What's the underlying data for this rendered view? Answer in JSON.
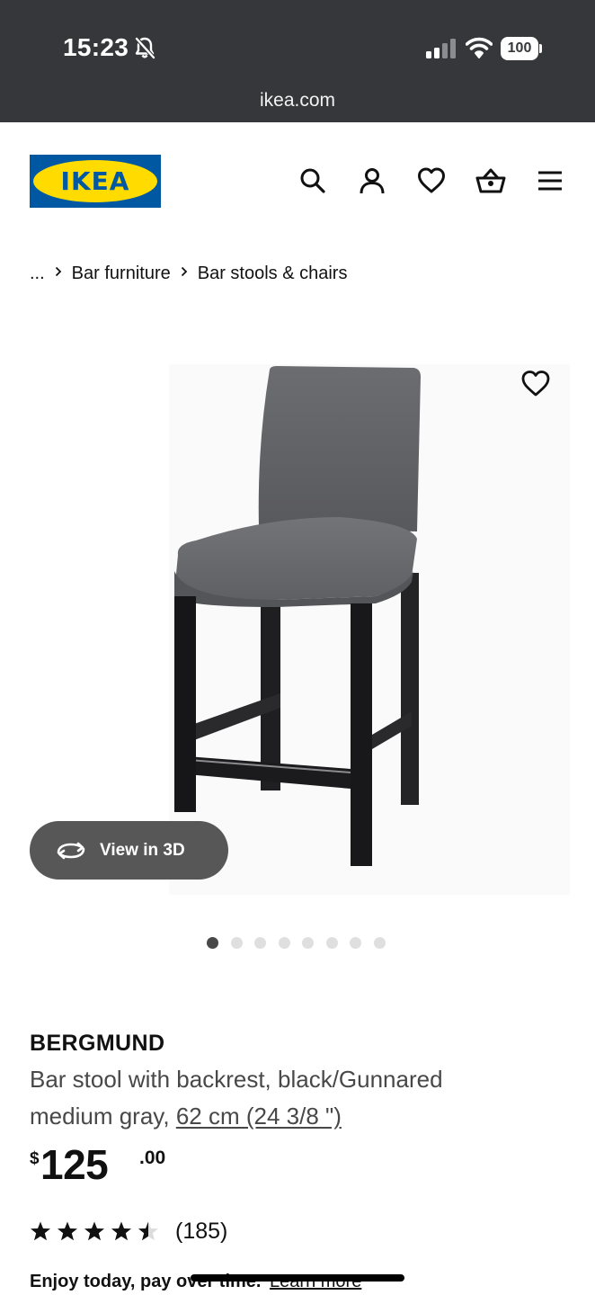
{
  "status_bar": {
    "time": "15:23",
    "battery": "100",
    "url": "ikea.com",
    "icons": [
      "bell-slash-icon",
      "signal-icon",
      "wifi-icon",
      "battery-icon"
    ]
  },
  "header": {
    "logo_text": "IKEA",
    "icons": [
      "search-icon",
      "account-icon",
      "heart-icon",
      "basket-icon",
      "menu-icon"
    ]
  },
  "breadcrumb": {
    "ellipsis": "...",
    "items": [
      "Bar furniture",
      "Bar stools & chairs"
    ]
  },
  "gallery": {
    "view_3d_label": "View in 3D",
    "dot_count": 8,
    "active_dot": 0
  },
  "product": {
    "name": "BERGMUND",
    "description": "Bar stool with backrest, black/Gunnared medium gray,",
    "size": "62 cm (24 3/8 \")",
    "price": {
      "currency": "$",
      "integer": "125",
      "decimal": ".00"
    },
    "rating": 4.5,
    "review_count": "(185)",
    "payment_text": "Enjoy today, pay over time.",
    "payment_link": "Learn more"
  },
  "colors": {
    "ikea_blue": "#0058a3",
    "ikea_yellow": "#ffdb00",
    "status_bar_bg": "#35373a",
    "text_primary": "#111111",
    "text_secondary": "#484848"
  }
}
